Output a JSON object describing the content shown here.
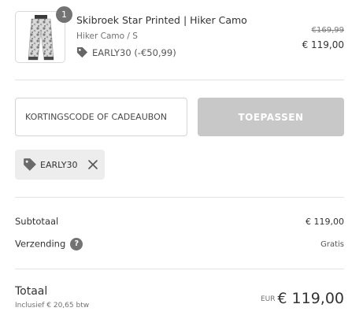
{
  "product": {
    "quantity": "1",
    "title": "Skibroek Star Printed | Hiker Camo",
    "variant": "Hiker Camo / S",
    "discount": "EARLY30 (-€50,99)",
    "original_price": "€169,99",
    "price": "€ 119,00"
  },
  "discount_form": {
    "placeholder": "KORTINGSCODE OF CADEAUBON",
    "apply_label": "TOEPASSEN"
  },
  "applied_code": {
    "code": "EARLY30"
  },
  "summary": {
    "subtotal_label": "Subtotaal",
    "subtotal_value": "€ 119,00",
    "shipping_label": "Verzending",
    "shipping_help": "?",
    "shipping_value": "Gratis"
  },
  "total": {
    "label": "Totaal",
    "tax_note": "Inclusief € 20,65 btw",
    "currency": "EUR",
    "amount": "€ 119,00"
  },
  "icons": [
    "tag-icon",
    "close-icon",
    "question-icon"
  ],
  "colors": {
    "badge": "#737373",
    "button_disabled": "#c8c8c8",
    "chip_bg": "#ededed"
  }
}
